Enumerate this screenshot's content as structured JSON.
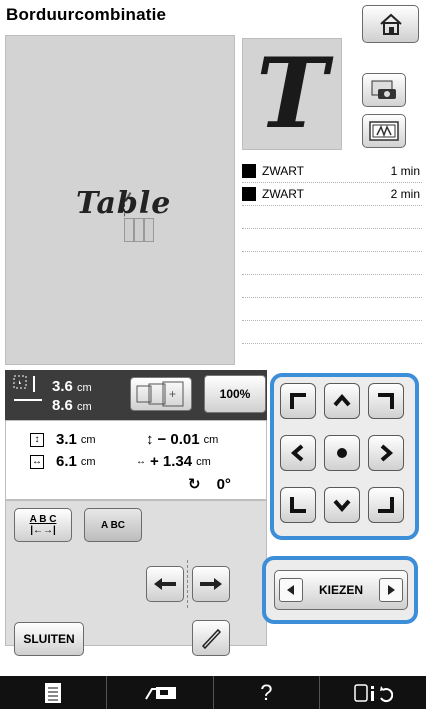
{
  "header": {
    "title": "Borduurcombinatie"
  },
  "canvas": {
    "text": "Table"
  },
  "preview": {
    "letter": "T"
  },
  "threads": [
    {
      "color": "#000000",
      "name": "ZWART",
      "time": "1 min"
    },
    {
      "color": "#000000",
      "name": "ZWART",
      "time": "2 min"
    }
  ],
  "size": {
    "width_value": "3.6",
    "height_value": "8.6",
    "unit": "cm"
  },
  "zoom": {
    "label": "100%"
  },
  "position": {
    "vertical_value": "3.1",
    "horizontal_value": "6.1",
    "offset_v_value": "− 0.01",
    "offset_h_value": "+ 1.34",
    "rotation_value": "0°",
    "unit": "cm"
  },
  "buttons": {
    "abc_label": "A B C",
    "a_bc_label": "A BC",
    "close_label": "SLUITEN",
    "select_label": "KIEZEN"
  },
  "icons": {
    "home": "home-icon",
    "scan": "camera-icon",
    "stitch": "stitch-icon",
    "dpad_center": "dot-icon",
    "bottom": [
      "list-icon",
      "machine-icon",
      "help-icon",
      "settings-icon"
    ]
  },
  "accent": "#3d8ed8"
}
